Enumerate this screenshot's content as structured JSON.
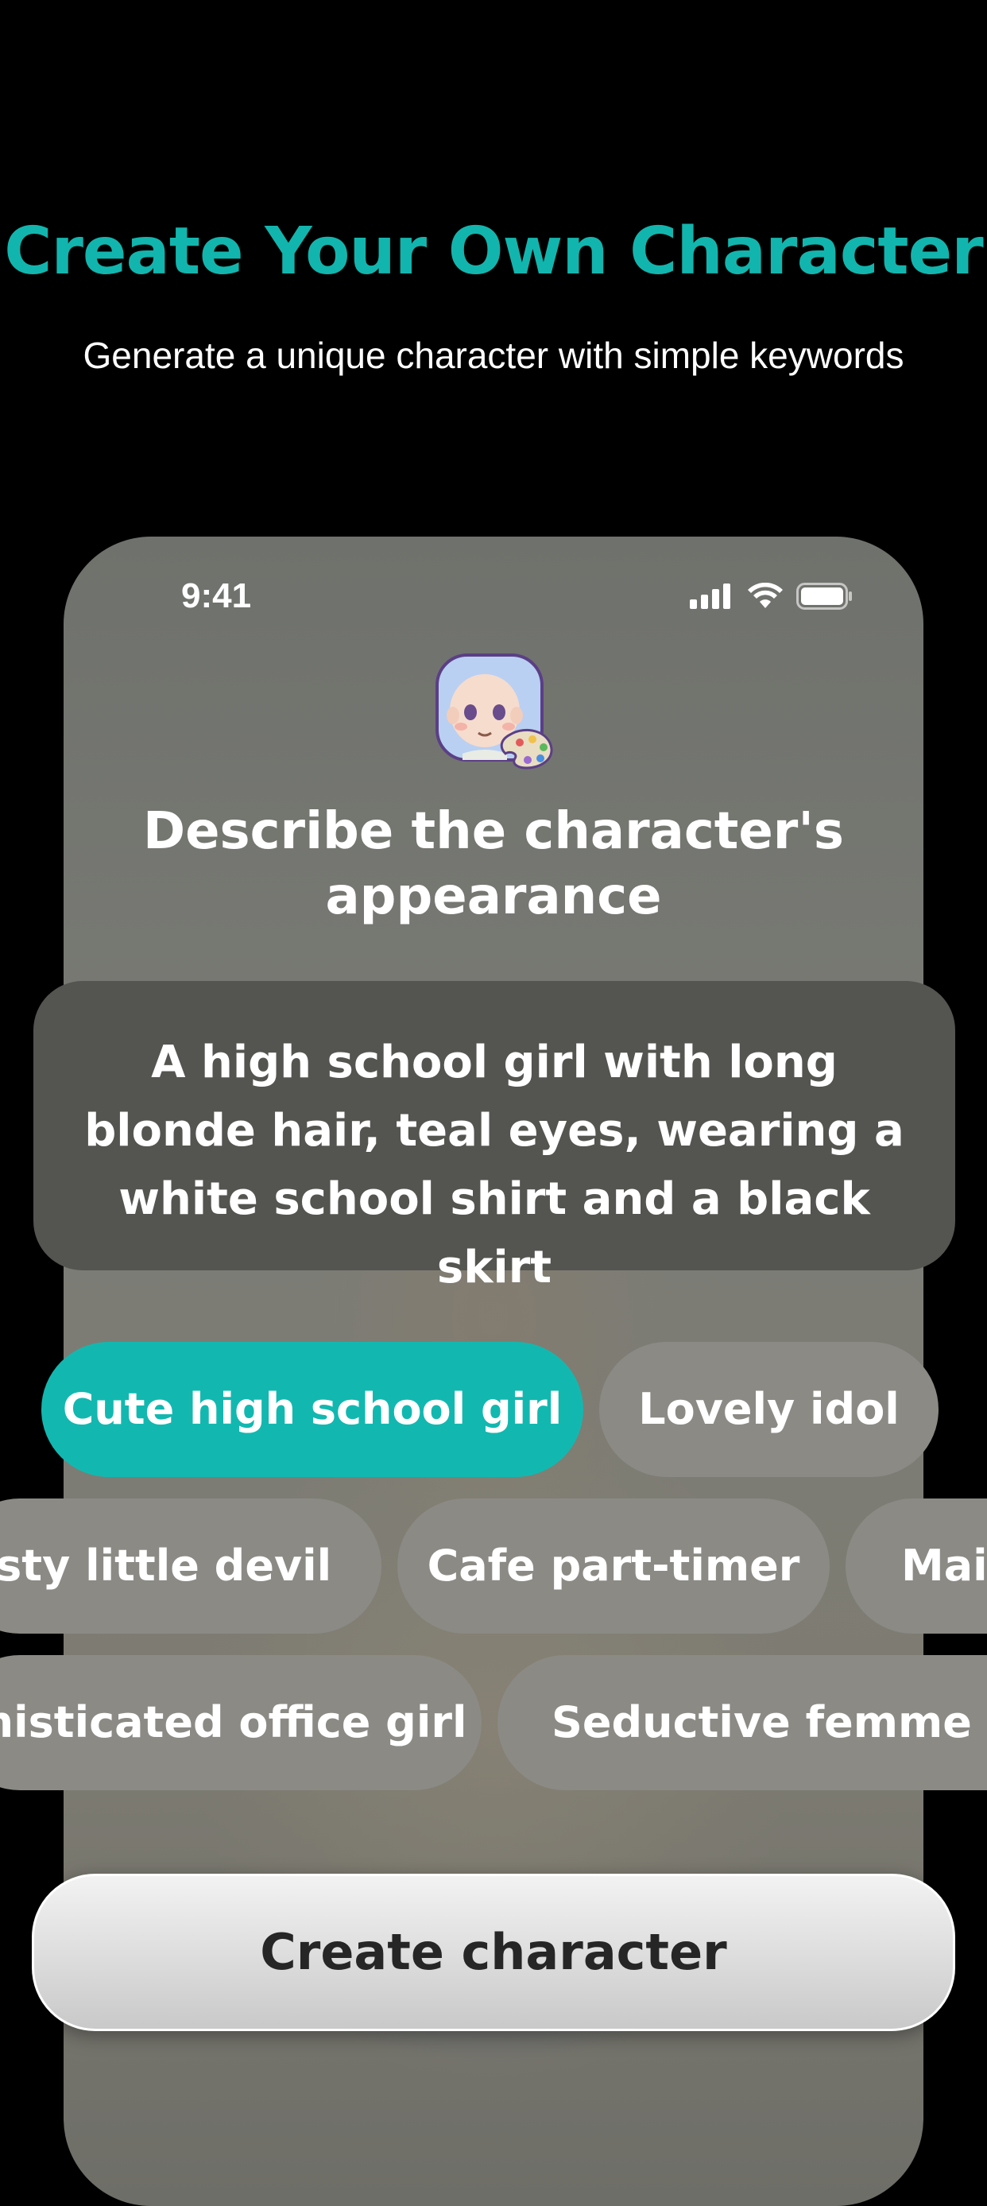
{
  "header": {
    "title": "Create Your Own Character",
    "subtitle": "Generate a unique character with simple keywords"
  },
  "phone": {
    "status_time": "9:41",
    "status_icons": [
      "cellular-signal-icon",
      "wifi-icon",
      "battery-icon"
    ],
    "avatar_icon": "baby-face-with-palette-icon",
    "title": "Describe the character's appearance",
    "title_line1": "Describe the character's",
    "title_line2": "appearance"
  },
  "prompt": {
    "text": "A high school girl with long blonde hair, teal eyes, wearing a white school shirt and a black skirt"
  },
  "chips": {
    "row1": [
      "Cute high school girl",
      "Lovely idol"
    ],
    "row2": [
      "eisty little devil",
      "Cafe part-timer",
      "Maic"
    ],
    "row3": [
      "phisticated office girl",
      "Seductive femme fat"
    ],
    "selected": "Cute high school girl"
  },
  "actions": {
    "create_label": "Create character"
  },
  "colors": {
    "accent": "#12b5ad",
    "background": "#000000",
    "chip": "#8b8a85",
    "prompt_box": "#545450"
  }
}
